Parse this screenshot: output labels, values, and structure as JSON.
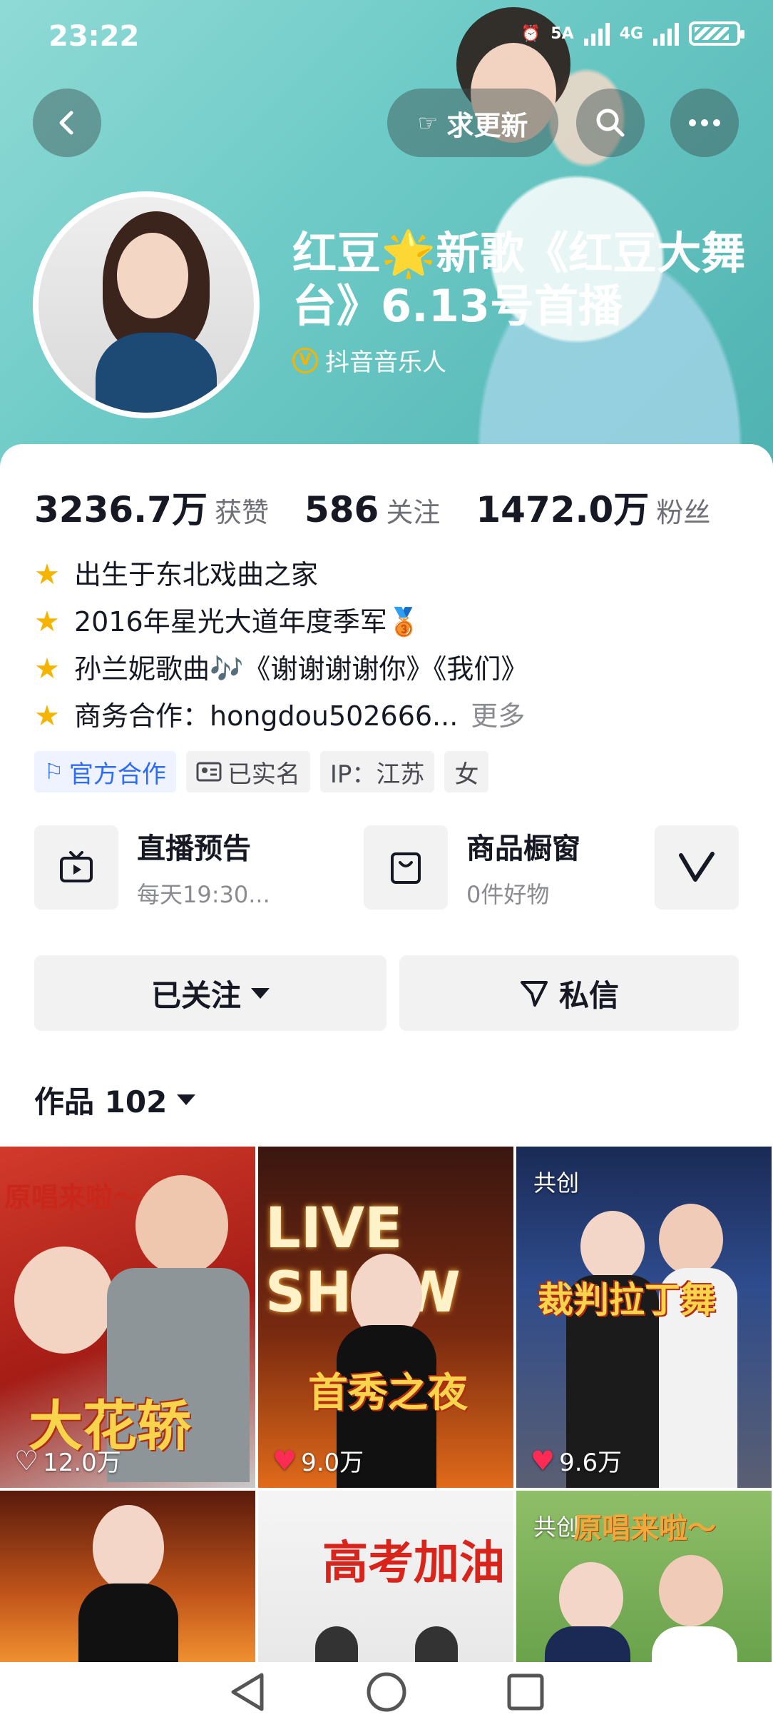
{
  "status_bar": {
    "time": "23:22",
    "network_a": "5A",
    "network_b": "4G"
  },
  "header": {
    "request_update_label": "求更新",
    "display_name": "红豆🌟新歌《红豆大舞台》6.13号首播",
    "verified_label": "抖音音乐人"
  },
  "stats": [
    {
      "value": "3236.7万",
      "label": "获赞"
    },
    {
      "value": "586",
      "label": "关注"
    },
    {
      "value": "1472.0万",
      "label": "粉丝"
    }
  ],
  "bio": [
    "出生于东北戏曲之家",
    "2016年星光大道年度季军🥉",
    "孙兰妮歌曲🎶《谢谢谢谢你》《我们》",
    "商务合作：hongdou502666..."
  ],
  "bio_more": "更多",
  "tags": [
    {
      "label": "官方合作",
      "icon": "cooperation-icon"
    },
    {
      "label": "已实名",
      "icon": "id-card-icon"
    },
    {
      "label": "IP：江苏"
    },
    {
      "label": "女"
    }
  ],
  "features": [
    {
      "title": "直播预告",
      "subtitle": "每天19:30...",
      "icon": "tv-icon"
    },
    {
      "title": "商品橱窗",
      "subtitle": "0件好物",
      "icon": "shopping-bag-icon"
    }
  ],
  "actions": {
    "follow_label": "已关注",
    "message_label": "私信"
  },
  "works": {
    "label": "作品 102"
  },
  "videos": [
    {
      "likes": "12.0万",
      "caption": "大花轿",
      "top_text": "原唱来啦～",
      "liked": false
    },
    {
      "likes": "9.0万",
      "caption": "首秀之夜",
      "top_text": "LIVE SHOW",
      "liked": true
    },
    {
      "likes": "9.6万",
      "caption": "裁判拉丁舞",
      "badge": "共创",
      "liked": true
    },
    {
      "likes": "",
      "caption": ""
    },
    {
      "likes": "",
      "caption": "高考加油"
    },
    {
      "likes": "",
      "caption": "原唱来啦～",
      "badge": "共创"
    }
  ],
  "colors": {
    "accent_red": "#fe2c55",
    "banner_teal": "#6fcbc7",
    "link_blue": "#2e6cf6",
    "star_gold": "#f5b400"
  }
}
